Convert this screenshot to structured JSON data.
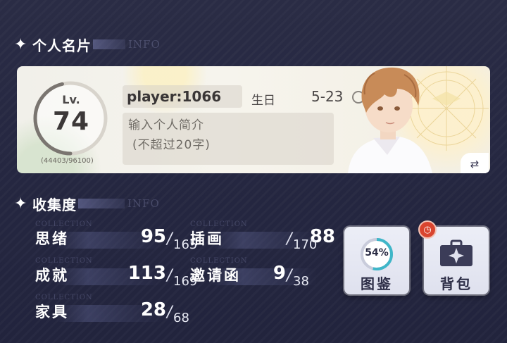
{
  "card_section": {
    "title": "个人名片",
    "ghost": "INFO"
  },
  "profile": {
    "level_label": "Lv.",
    "level": "74",
    "exp": "(44403/96100)",
    "exp_fraction": 0.462,
    "player_name": "player:1066",
    "birthday_label": "生日",
    "birthday": "5-23",
    "intro_line1": "输入个人简介",
    "intro_line2": "(不超过20字)"
  },
  "collection_section": {
    "title": "收集度",
    "ghost": "INFO"
  },
  "stats": {
    "ghost": "COLLECTION",
    "thoughts": {
      "label": "思绪",
      "value": "95",
      "total": "165"
    },
    "illustrations": {
      "label": "插画",
      "value": "88",
      "total": "170"
    },
    "achievements": {
      "label": "成就",
      "value": "113",
      "total": "169"
    },
    "invitations": {
      "label": "邀请函",
      "value": "9",
      "total": "38"
    },
    "furniture": {
      "label": "家具",
      "value": "28",
      "total": "68"
    }
  },
  "buttons": {
    "atlas": {
      "label": "图鉴",
      "percent": "54%",
      "fraction": 0.54
    },
    "bag": {
      "label": "背包"
    }
  },
  "colors": {
    "accent_teal": "#3fb6c8",
    "badge_red": "#d9452f",
    "background": "#272943"
  }
}
